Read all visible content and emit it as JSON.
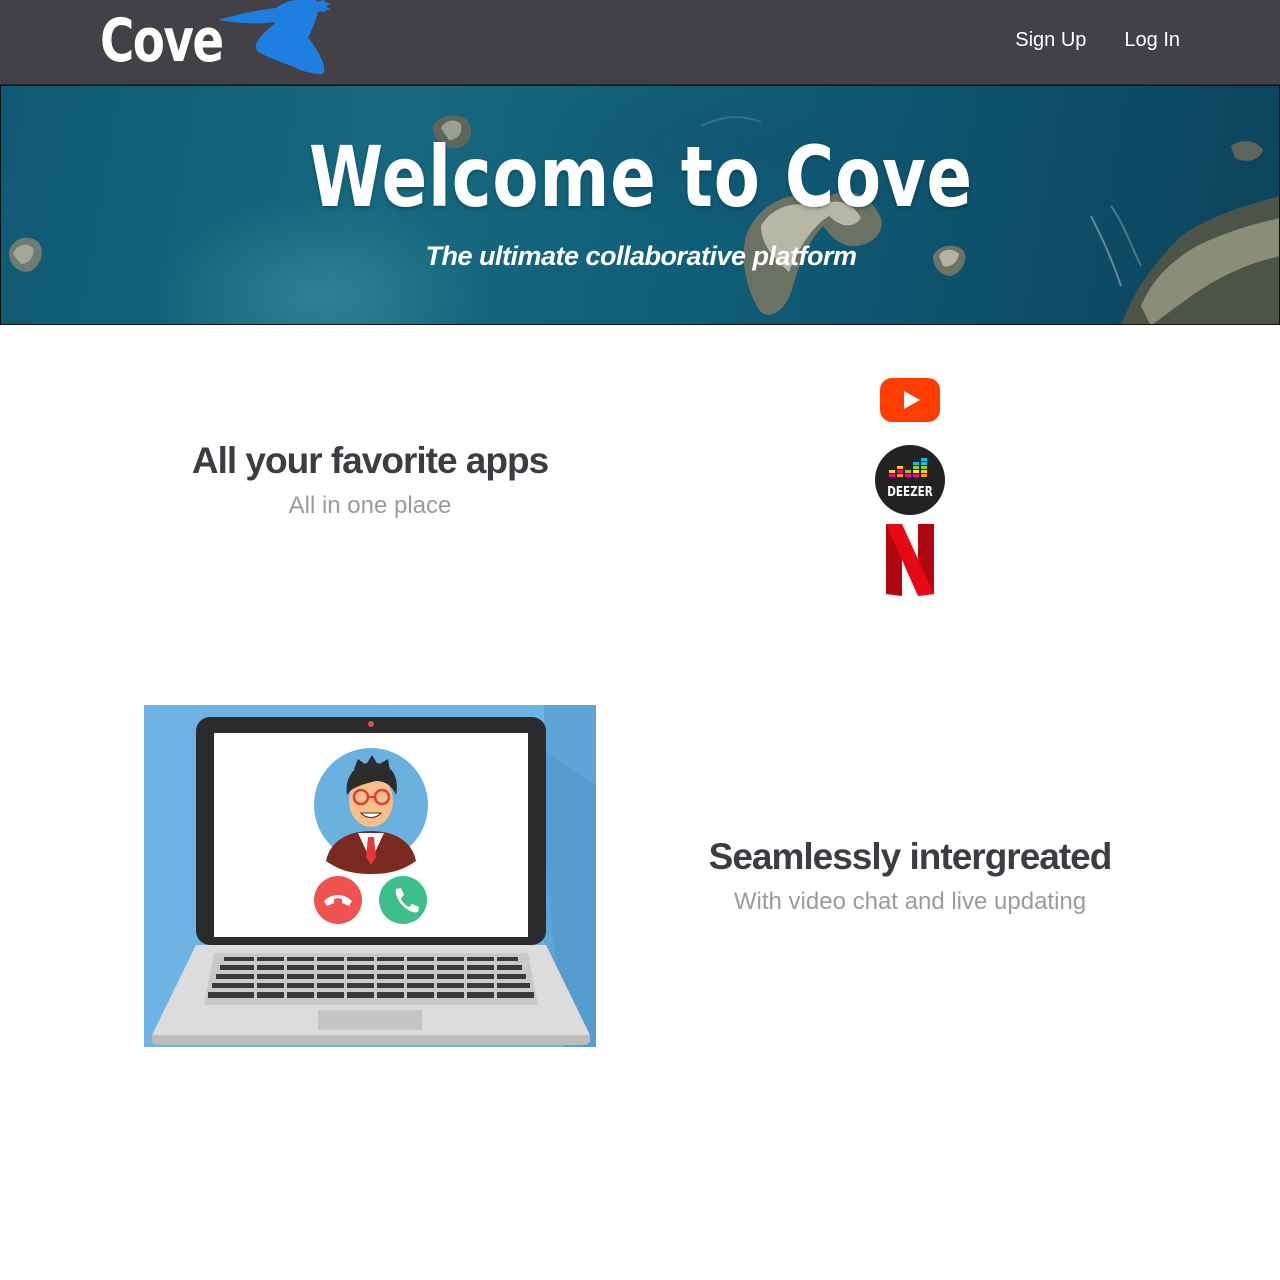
{
  "navbar": {
    "logo_text": "Cove",
    "links": [
      {
        "label": "Sign Up"
      },
      {
        "label": "Log In"
      }
    ]
  },
  "hero": {
    "title": "Welcome to Cove",
    "subtitle": "The ultimate collaborative platform"
  },
  "features": [
    {
      "title": "All your favorite apps",
      "subtitle": "All in one place",
      "apps": [
        {
          "icon": "youtube-icon",
          "color": "#ff3d00"
        },
        {
          "icon": "deezer-icon",
          "color": "#222222",
          "label": "DEEZER"
        },
        {
          "icon": "netflix-icon",
          "color": "#e50914"
        }
      ]
    },
    {
      "title": "Seamlessly intergreated",
      "subtitle": "With video chat and live updating",
      "illustration": "laptop-video-call-illustration"
    }
  ],
  "colors": {
    "navbar": "#434046",
    "accent_blue": "#1f7fe0",
    "heading": "#3e3c42",
    "subtext": "#9b9b9b"
  }
}
